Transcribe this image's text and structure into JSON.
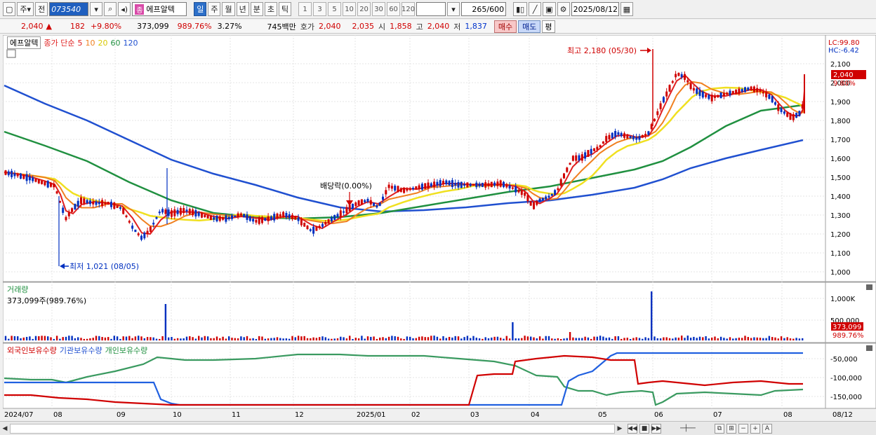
{
  "toolbar": {
    "period_main": "주",
    "prev": "전",
    "code": "073540",
    "badge": "종",
    "name": "에프알텍",
    "periods": [
      "일",
      "주",
      "월",
      "년",
      "분",
      "초",
      "틱"
    ],
    "active_period": "일",
    "numbers": [
      "1",
      "3",
      "5",
      "10",
      "20",
      "30",
      "60",
      "120"
    ],
    "count": "265",
    "count_total": "/600",
    "date": "2025/08/12"
  },
  "quote": {
    "price": "2,040",
    "arrow": "▲",
    "change": "182",
    "change_pct": "+9.80%",
    "volume": "373,099",
    "volume_pct": "989.76%",
    "turnover": "3.27%",
    "amount": "745백만",
    "ask_label": "호가",
    "ask": "2,040",
    "bid": "2,035",
    "open_label": "시",
    "open": "1,858",
    "high_label": "고",
    "high": "2,040",
    "low_label": "저",
    "low": "1,837",
    "buy": "매수",
    "sell": "매도",
    "avg": "평"
  },
  "price_panel": {
    "stock": "에프알텍",
    "legend_title": "종가 단순",
    "ma_labels": [
      "5",
      "10",
      "20",
      "60",
      "120"
    ],
    "lc": "LC:99.80",
    "hc": "HC:-6.42",
    "price_tag": "2,040",
    "pct_tag": "9.80%",
    "high_note": "최고 2,180 (05/30)",
    "low_note": "최저 1,021 (08/05)",
    "dividend_note": "배당락(0.00%)",
    "y_ticks": [
      "2,100",
      "2,000",
      "1,900",
      "1,800",
      "1,700",
      "1,600",
      "1,500",
      "1,400",
      "1,300",
      "1,200",
      "1,100",
      "1,000"
    ]
  },
  "volume_panel": {
    "title": "거래량",
    "value": "373,099주(989.76%)",
    "y_ticks": [
      "1,000K",
      "500,000"
    ],
    "tag_value": "373,099",
    "tag_pct": "989.76%"
  },
  "holding_panel": {
    "legend": [
      "외국인보유수량",
      "기관보유수량",
      "개인보유수량"
    ],
    "y_ticks": [
      "-50,000",
      "-100,000",
      "-150,000"
    ]
  },
  "x_axis": [
    "2024/07",
    "08",
    "09",
    "10",
    "11",
    "12",
    "2025/01",
    "02",
    "03",
    "04",
    "05",
    "06",
    "07",
    "08",
    "08/12"
  ],
  "colors": {
    "candle_up": "#d00000",
    "candle_down": "#0030c0",
    "ma5": "#e02020",
    "ma10": "#f08020",
    "ma20": "#f0e020",
    "ma60": "#209040",
    "ma120": "#2050d0"
  }
}
